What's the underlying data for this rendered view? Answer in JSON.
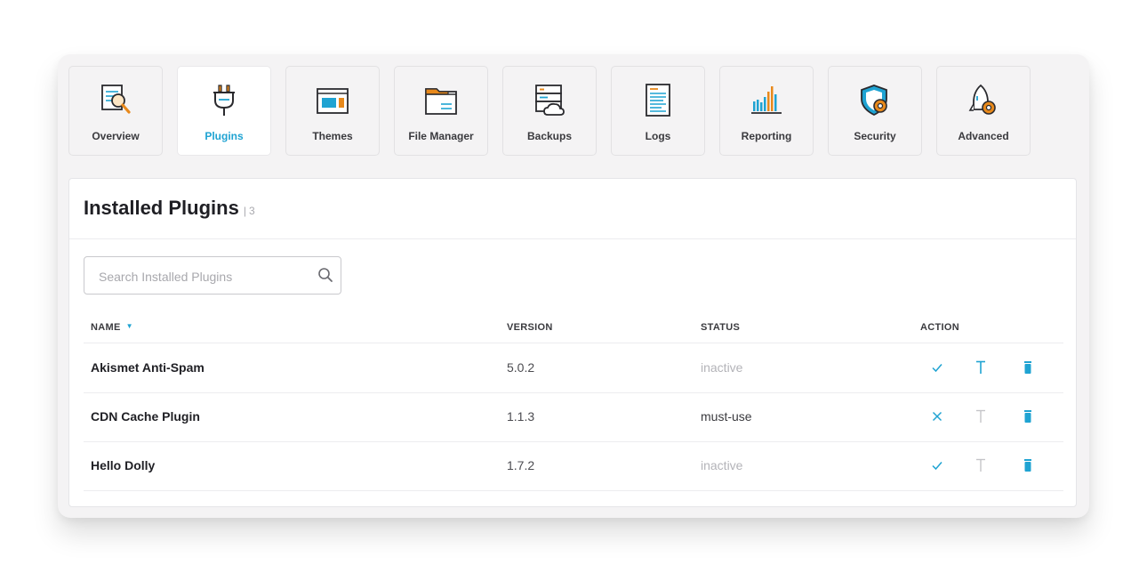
{
  "colors": {
    "accent": "#1fa3d2",
    "muted": "#c4c4c8",
    "panel_bg": "#f4f3f4"
  },
  "tabs": [
    {
      "label": "Overview",
      "icon": "overview-icon",
      "active": false
    },
    {
      "label": "Plugins",
      "icon": "plugin-icon",
      "active": true
    },
    {
      "label": "Themes",
      "icon": "themes-icon",
      "active": false
    },
    {
      "label": "File Manager",
      "icon": "folder-icon",
      "active": false
    },
    {
      "label": "Backups",
      "icon": "backups-icon",
      "active": false
    },
    {
      "label": "Logs",
      "icon": "logs-icon",
      "active": false
    },
    {
      "label": "Reporting",
      "icon": "reporting-icon",
      "active": false
    },
    {
      "label": "Security",
      "icon": "security-shield-icon",
      "active": false
    },
    {
      "label": "Advanced",
      "icon": "rocket-gear-icon",
      "active": false
    }
  ],
  "section": {
    "title": "Installed Plugins",
    "count_separator": "|",
    "count": "3"
  },
  "search": {
    "placeholder": "Search Installed Plugins",
    "value": ""
  },
  "table": {
    "columns": {
      "name": "NAME",
      "version": "VERSION",
      "status": "STATUS",
      "action": "ACTION"
    },
    "rows": [
      {
        "name": "Akismet Anti-Spam",
        "version": "5.0.2",
        "status": "inactive",
        "action_state": "activate",
        "update_enabled": true
      },
      {
        "name": "CDN Cache Plugin",
        "version": "1.1.3",
        "status": "must-use",
        "action_state": "deactivate",
        "update_enabled": false
      },
      {
        "name": "Hello Dolly",
        "version": "1.7.2",
        "status": "inactive",
        "action_state": "activate",
        "update_enabled": false
      }
    ]
  }
}
